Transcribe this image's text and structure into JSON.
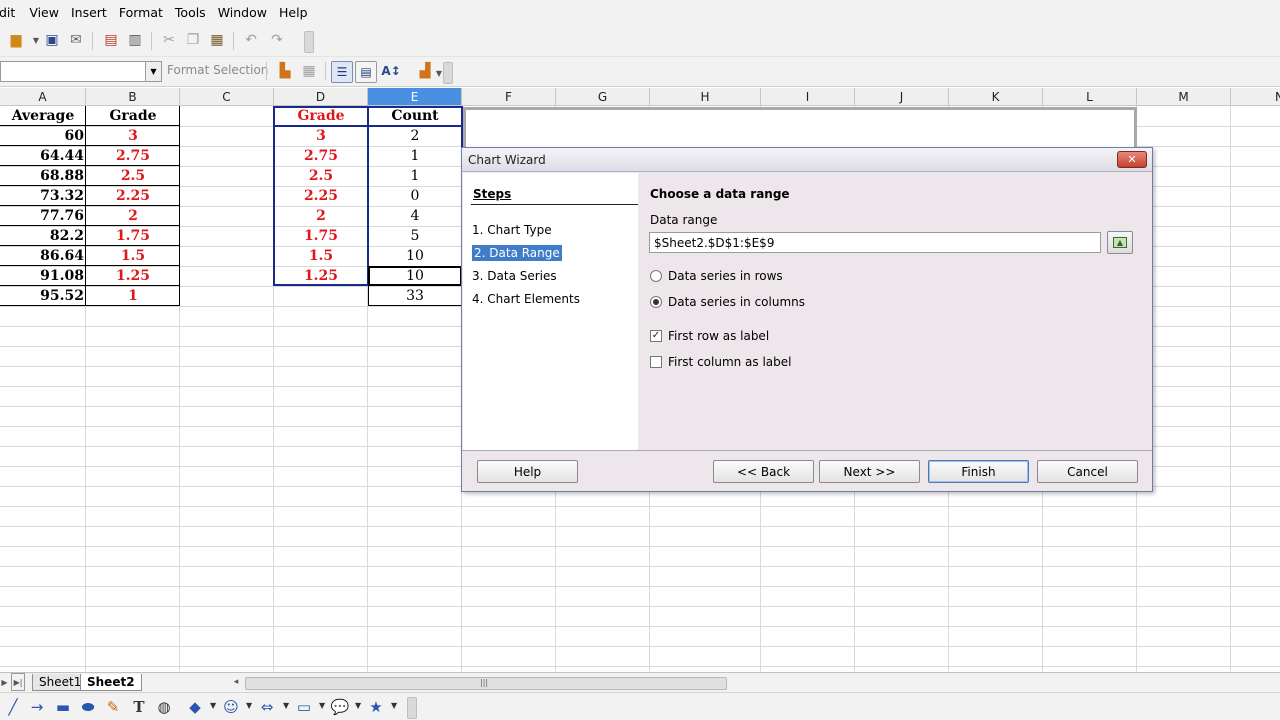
{
  "menu": [
    "dit",
    "View",
    "Insert",
    "Format",
    "Tools",
    "Window",
    "Help"
  ],
  "toolbar": {
    "format_selection": "Format Selection"
  },
  "columns": [
    "A",
    "B",
    "C",
    "D",
    "E",
    "F",
    "G",
    "H",
    "I",
    "J",
    "K",
    "L",
    "M",
    "N"
  ],
  "table_left": {
    "headers": [
      "Average",
      "Grade"
    ],
    "rows": [
      [
        "60",
        "3"
      ],
      [
        "64.44",
        "2.75"
      ],
      [
        "68.88",
        "2.5"
      ],
      [
        "73.32",
        "2.25"
      ],
      [
        "77.76",
        "2"
      ],
      [
        "82.2",
        "1.75"
      ],
      [
        "86.64",
        "1.5"
      ],
      [
        "91.08",
        "1.25"
      ],
      [
        "95.52",
        "1"
      ]
    ]
  },
  "table_right": {
    "headers": [
      "Grade",
      "Count"
    ],
    "rows": [
      [
        "3",
        "2"
      ],
      [
        "2.75",
        "1"
      ],
      [
        "2.5",
        "1"
      ],
      [
        "2.25",
        "0"
      ],
      [
        "2",
        "4"
      ],
      [
        "1.75",
        "5"
      ],
      [
        "1.5",
        "10"
      ],
      [
        "1.25",
        "10"
      ]
    ],
    "total": "33"
  },
  "sheets": [
    "Sheet1",
    "Sheet2"
  ],
  "dialog": {
    "title": "Chart Wizard",
    "close": "✕",
    "steps_title": "Steps",
    "steps": [
      "1. Chart Type",
      "2. Data Range",
      "3. Data Series",
      "4. Chart Elements"
    ],
    "current_step": "2. Data Range",
    "heading": "Choose a data range",
    "range_label": "Data range",
    "range_value": "$Sheet2.$D$1:$E$9",
    "option_rows": "Data series in rows",
    "option_columns": "Data series in columns",
    "first_row_label": "First row as label",
    "first_col_label": "First column as label",
    "first_row_check": "✓",
    "buttons": {
      "help": "Help",
      "back": "<< Back",
      "next": "Next >>",
      "finish": "Finish",
      "cancel": "Cancel"
    }
  }
}
